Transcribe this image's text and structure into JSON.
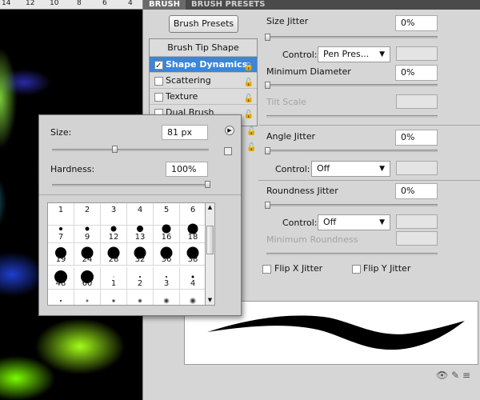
{
  "ruler": {
    "labels": [
      "14",
      "12",
      "10",
      "8",
      "6",
      "4"
    ]
  },
  "panel": {
    "tabs": [
      "BRUSH",
      "BRUSH PRESETS"
    ],
    "presets_button": "Brush Presets",
    "list": {
      "header": "Brush Tip Shape",
      "items": [
        {
          "label": "Shape Dynamics",
          "checked": true
        },
        {
          "label": "Scattering",
          "checked": false
        },
        {
          "label": "Texture",
          "checked": false
        },
        {
          "label": "Dual Brush",
          "checked": false
        }
      ]
    },
    "size_jitter": {
      "label": "Size Jitter",
      "value": "0%"
    },
    "control1": {
      "label": "Control:",
      "value": "Pen Pres..."
    },
    "min_diameter": {
      "label": "Minimum Diameter",
      "value": "0%"
    },
    "tilt_scale": {
      "label": "Tilt Scale"
    },
    "angle_jitter": {
      "label": "Angle Jitter",
      "value": "0%"
    },
    "control2": {
      "label": "Control:",
      "value": "Off"
    },
    "roundness_jitter": {
      "label": "Roundness Jitter",
      "value": "0%"
    },
    "control3": {
      "label": "Control:",
      "value": "Off"
    },
    "min_roundness": {
      "label": "Minimum Roundness"
    },
    "flip_x": {
      "label": "Flip X Jitter"
    },
    "flip_y": {
      "label": "Flip Y Jitter"
    }
  },
  "popup": {
    "size_label": "Size:",
    "size_value": "81 px",
    "hardness_label": "Hardness:",
    "hardness_value": "100%",
    "brush_rows": [
      [
        "1",
        "2",
        "3",
        "4",
        "5",
        "6"
      ],
      [
        "7",
        "9",
        "12",
        "13",
        "16",
        "18"
      ],
      [
        "19",
        "24",
        "28",
        "32",
        "36",
        "38"
      ],
      [
        "48",
        "60",
        "1",
        "2",
        "3",
        "4"
      ]
    ]
  },
  "colors": {
    "selected": "#3a86d8",
    "panel_bg": "#d6d6d6",
    "tab_bar": "#4a4a4a"
  }
}
